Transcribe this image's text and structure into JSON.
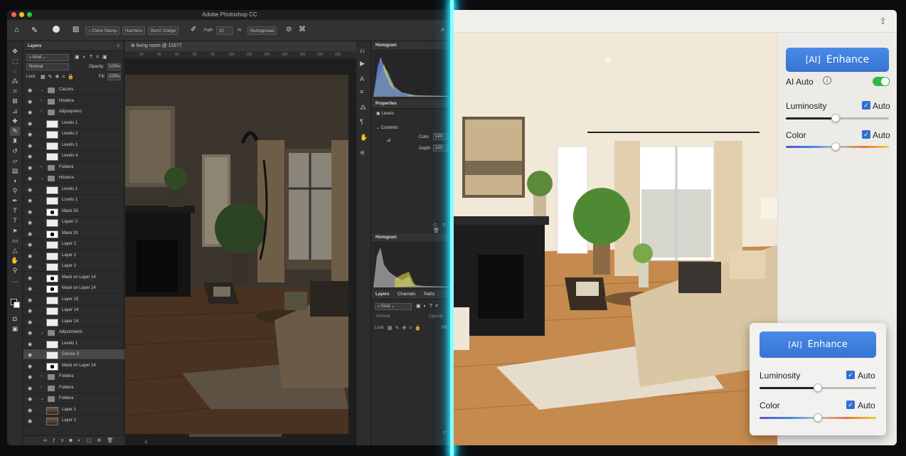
{
  "photoshop": {
    "app_title": "Adobe Photoshop CC",
    "options_bar": {
      "clone_stamp": "Clone Stamp",
      "hardness": "Harrness",
      "burn_dodge": "Burn'r Dodge",
      "path_label": "Path",
      "path_value": "10",
      "percent": "%",
      "smoothing": "Nurtoppreaa"
    },
    "document_tab": "living room @ 11677",
    "ruler_ticks": [
      "30",
      "40",
      "60",
      "80",
      "90",
      "100",
      "120",
      "140",
      "160",
      "180",
      "200",
      "220"
    ],
    "status_value": "-1",
    "layers_panel": {
      "title": "Layers",
      "kind": "Kind",
      "blend_mode": "Normal",
      "opacity_label": "Opacity",
      "opacity_value": "100%",
      "lock_label": "Lock",
      "fill_label": "Fill",
      "fill_value": "100%",
      "rows": [
        {
          "name": "Cacons",
          "kind": "group-open"
        },
        {
          "name": "Hisdera",
          "kind": "folder"
        },
        {
          "name": "Adjosqueno",
          "kind": "folder"
        },
        {
          "name": "Levels 1",
          "kind": "layer"
        },
        {
          "name": "Levels 2",
          "kind": "layer"
        },
        {
          "name": "Levels 1",
          "kind": "layer"
        },
        {
          "name": "Levels 4",
          "kind": "layer"
        },
        {
          "name": "Foldera",
          "kind": "folder"
        },
        {
          "name": "Hisdora",
          "kind": "group-open"
        },
        {
          "name": "Levels 1",
          "kind": "layer"
        },
        {
          "name": "Lcvels 1",
          "kind": "layer"
        },
        {
          "name": "Mask 33",
          "kind": "mask"
        },
        {
          "name": "Layerr 2",
          "kind": "layer"
        },
        {
          "name": "Mask 33",
          "kind": "mask"
        },
        {
          "name": "Layer 2",
          "kind": "layer"
        },
        {
          "name": "Layer 2",
          "kind": "layer"
        },
        {
          "name": "Layer 2",
          "kind": "layer"
        },
        {
          "name": "Mask on Layer 14",
          "kind": "mask"
        },
        {
          "name": "Mask on Layer 14",
          "kind": "mask"
        },
        {
          "name": "Layer 15",
          "kind": "layer"
        },
        {
          "name": "Layer 14",
          "kind": "layer"
        },
        {
          "name": "Layer 14",
          "kind": "layer"
        },
        {
          "name": "Adjustments",
          "kind": "group-open"
        },
        {
          "name": "Levels 1",
          "kind": "layer"
        },
        {
          "name": "Cerves 3",
          "kind": "layer-selected"
        },
        {
          "name": "Mask on Layer 14",
          "kind": "mask"
        },
        {
          "name": "Foldera",
          "kind": "folder"
        },
        {
          "name": "Foldera",
          "kind": "folder"
        },
        {
          "name": "Foldera",
          "kind": "group-open"
        },
        {
          "name": "Layer 1",
          "kind": "photo"
        },
        {
          "name": "Layer 2",
          "kind": "photo"
        }
      ]
    },
    "histogram_title": "Histogram",
    "properties": {
      "title": "Properties",
      "levels": "Levels",
      "contents": "Contents",
      "color_label": "Color",
      "color_value": "123",
      "depth_label": "Depth",
      "depth_value": "123"
    },
    "histogram2_title": "Histogram",
    "bottom_tabs": [
      "Layers",
      "Channels",
      "Paths"
    ],
    "bottom_kind": "Kind",
    "bottom_blend": "Normal",
    "bottom_opacity": "Opacity",
    "bottom_lock": "Lock",
    "bottom_fill": "Fill"
  },
  "enhance_app": {
    "enhance_label": "Enhance",
    "ai_auto_label": "AI Auto",
    "ai_auto_on": true,
    "luminosity_label": "Luminosity",
    "color_label": "Color",
    "auto_label": "Auto",
    "luminosity_level": 0.48,
    "color_level": 0.48,
    "floating_panel": {
      "enhance_label": "Enhance",
      "luminosity_label": "Luminosity",
      "color_label": "Color",
      "auto_label": "Auto",
      "luminosity_level": 0.5,
      "color_level": 0.5
    },
    "accent_color": "#3574d4",
    "toggle_color": "#2eb84a"
  }
}
